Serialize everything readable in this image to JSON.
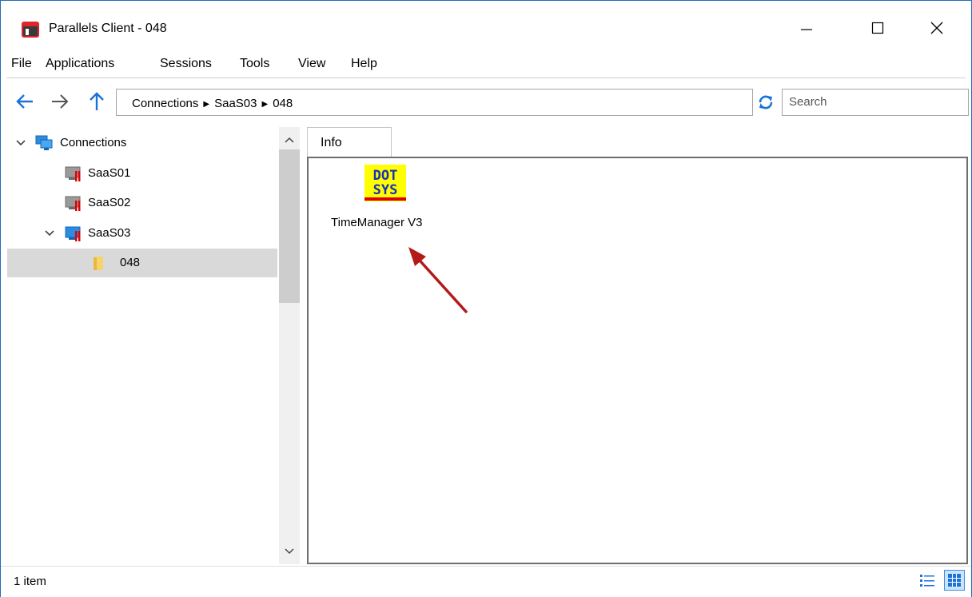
{
  "window": {
    "title": "Parallels Client - 048"
  },
  "menu": {
    "items": [
      "File",
      "Applications",
      "Sessions",
      "Tools",
      "View",
      "Help"
    ]
  },
  "address": {
    "crumbs": [
      "Connections",
      "SaaS03",
      "048"
    ]
  },
  "search": {
    "placeholder": "Search"
  },
  "tree": {
    "items": [
      {
        "label": "Connections",
        "icon": "monitor-icon",
        "level": 0,
        "expanded": true
      },
      {
        "label": "SaaS01",
        "icon": "server-disconnected-icon",
        "level": 1
      },
      {
        "label": "SaaS02",
        "icon": "server-disconnected-icon",
        "level": 1
      },
      {
        "label": "SaaS03",
        "icon": "server-connected-icon",
        "level": 1,
        "expanded": true
      },
      {
        "label": "048",
        "icon": "folder-icon",
        "level": 2,
        "selected": true
      }
    ]
  },
  "content": {
    "tab_label": "Info",
    "app": {
      "label": "TimeManager V3",
      "logo_line1": "DOT",
      "logo_line2": "SYS"
    }
  },
  "status": {
    "text": "1 item"
  },
  "colors": {
    "accent": "#1f6fb5",
    "selection": "#d9d9d9",
    "arrow": "#b31b1b",
    "logo_bg": "#ffff00",
    "logo_text": "#1a2fb8",
    "logo_bar": "#e00000"
  }
}
